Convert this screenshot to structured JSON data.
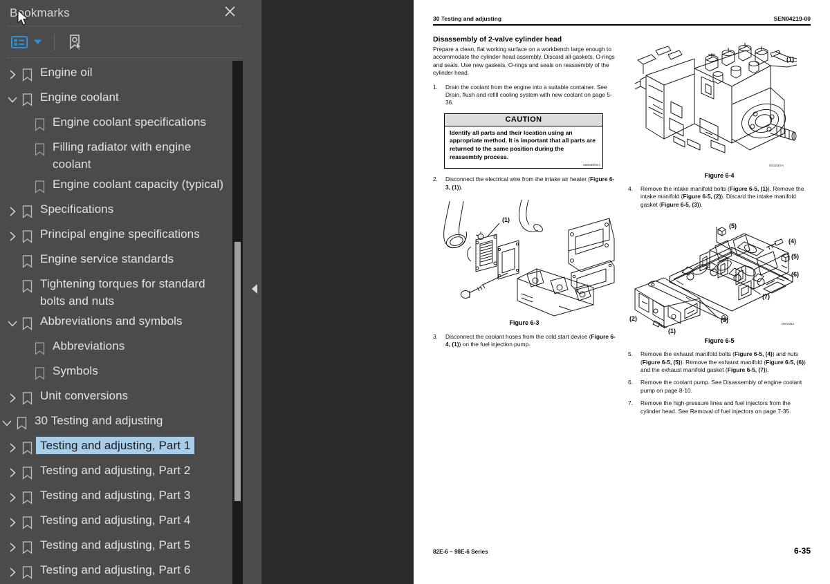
{
  "panel": {
    "title": "Bookmarks",
    "close_icon": "close-icon",
    "toolbar": {
      "options_icon": "bookmark-options-list-icon",
      "dropdown_icon": "chevron-down-icon",
      "new_bookmark_icon": "new-bookmark-icon",
      "accent_color": "#2f8fd8"
    },
    "selection_color": "#a8cde8",
    "background_color": "#4b4b4b"
  },
  "bookmarks": [
    {
      "label": "Engine oil",
      "level": 0,
      "twisty": "collapsed",
      "selected": false
    },
    {
      "label": "Engine coolant",
      "level": 0,
      "twisty": "expanded",
      "selected": false
    },
    {
      "label": "Engine coolant specifications",
      "level": 1,
      "twisty": "none",
      "selected": false
    },
    {
      "label": "Filling radiator with engine coolant",
      "level": 1,
      "twisty": "none",
      "selected": false
    },
    {
      "label": "Engine coolant capacity (typical)",
      "level": 1,
      "twisty": "none",
      "selected": false
    },
    {
      "label": "Specifications",
      "level": 0,
      "twisty": "collapsed",
      "selected": false
    },
    {
      "label": "Principal engine specifications",
      "level": 0,
      "twisty": "collapsed",
      "selected": false
    },
    {
      "label": "Engine service standards",
      "level": 0,
      "twisty": "none",
      "selected": false
    },
    {
      "label": "Tightening torques for standard bolts and nuts",
      "level": 0,
      "twisty": "none",
      "selected": false
    },
    {
      "label": "Abbreviations and symbols",
      "level": 0,
      "twisty": "expanded",
      "selected": false
    },
    {
      "label": "Abbreviations",
      "level": 1,
      "twisty": "none",
      "selected": false
    },
    {
      "label": "Symbols",
      "level": 1,
      "twisty": "none",
      "selected": false
    },
    {
      "label": "Unit conversions",
      "level": 0,
      "twisty": "collapsed",
      "selected": false
    },
    {
      "label": "30 Testing and adjusting",
      "level": -1,
      "twisty": "expanded",
      "selected": false
    },
    {
      "label": "Testing and adjusting, Part 1",
      "level": 0,
      "twisty": "collapsed",
      "selected": true
    },
    {
      "label": "Testing and adjusting, Part 2",
      "level": 0,
      "twisty": "collapsed",
      "selected": false
    },
    {
      "label": "Testing and adjusting, Part 3",
      "level": 0,
      "twisty": "collapsed",
      "selected": false
    },
    {
      "label": "Testing and adjusting, Part 4",
      "level": 0,
      "twisty": "collapsed",
      "selected": false
    },
    {
      "label": "Testing and adjusting, Part 5",
      "level": 0,
      "twisty": "collapsed",
      "selected": false
    },
    {
      "label": "Testing and adjusting, Part 6",
      "level": 0,
      "twisty": "collapsed",
      "selected": false
    }
  ],
  "splitter": {
    "collapse_icon": "collapse-panel-arrow-icon"
  },
  "document": {
    "header": {
      "left": "30 Testing and adjusting",
      "right": "SEN04219-00"
    },
    "footer": {
      "left": "82E-6 – 98E-6 Series",
      "right": "6-35"
    },
    "left_column": {
      "heading": "Disassembly of 2-valve cylinder head",
      "intro": "Prepare a clean, flat working surface on a workbench large enough to accommodate the cylinder head assembly. Discard all gaskets, O-rings and seals. Use new gaskets, O-rings and seals on reassembly of the cylinder head.",
      "step1_num": "1.",
      "step1_text": "Drain the coolant from the engine into a suitable container. See Drain, flush and refill cooling system with new coolant on page 5-36.",
      "caution": {
        "title": "CAUTION",
        "text": "Identify all parts and their location using an appropriate method. It is important that all parts are returned to the same position during the reassembly process.",
        "code": "0000080en"
      },
      "step2_num": "2.",
      "step2_text_a": "Disconnect the electrical wire from the intake air heater (",
      "step2_text_b": "Figure 6-3, (1)",
      "step2_text_c": ").",
      "figure63_caption": "Figure 6-3",
      "figure63_callout1": "(1)",
      "step3_num": "3.",
      "step3_text_a": "Disconnect the coolant hoses from the cold start device (",
      "step3_text_b": "Figure 6-4, (1)",
      "step3_text_c": ") on the fuel injection pump."
    },
    "right_column": {
      "figure64_caption": "Figure 6-4",
      "figure64_code": "0002087A",
      "figure64_callout1": "(1)",
      "step4_num": "4.",
      "step4_t1": "Remove the intake manifold bolts (",
      "step4_b1": "Figure 6-5, (1)",
      "step4_t2": "). Remove the intake manifold (",
      "step4_b2": "Figure 6-5, (2)",
      "step4_t3": "). Discard the intake manifold gasket (",
      "step4_b3": "Figure 6-5, (3)",
      "step4_t4": ").",
      "figure65_caption": "Figure 6-5",
      "figure65_code": "0001682",
      "figure65_callouts": [
        "(1)",
        "(2)",
        "(3)",
        "(4)",
        "(5)",
        "(5)",
        "(6)",
        "(7)"
      ],
      "step5_num": "5.",
      "step5_t1": "Remove the exhaust manifold bolts (",
      "step5_b1": "Figure 6-5, (4)",
      "step5_t2": ") and nuts (",
      "step5_b2": "Figure 6-5, (5)",
      "step5_t3": "). Remove the exhaust manifold (",
      "step5_b3": "Figure 6-5, (6)",
      "step5_t4": ") and the exhaust manifold gasket (",
      "step5_b4": "Figure 6-5, (7)",
      "step5_t5": ").",
      "step6_num": "6.",
      "step6_text": "Remove the coolant pump. See Disassembly of engine coolant pump on page 8-10.",
      "step7_num": "7.",
      "step7_text": "Remove the high-pressure lines and fuel injectors from the cylinder head. See Removal of fuel injectors on page 7-35."
    }
  }
}
